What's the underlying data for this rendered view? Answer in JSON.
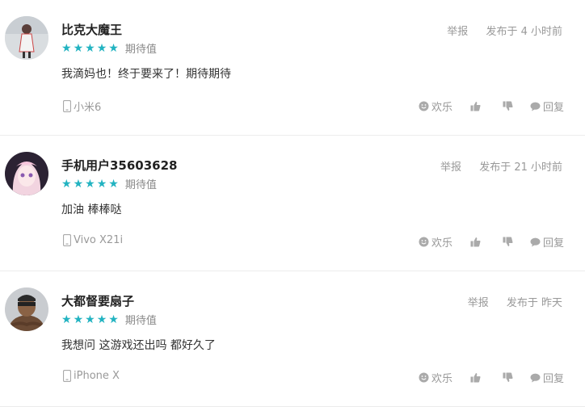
{
  "comments": [
    {
      "username": "比克大魔王",
      "report": "举报",
      "posted": "发布于 4 小时前",
      "rating_label": "期待值",
      "stars": 5,
      "content": "我滴妈也！终于要来了！期待期待",
      "device": "小米6",
      "actions": {
        "happy": "欢乐",
        "reply": "回复"
      }
    },
    {
      "username": "手机用户35603628",
      "report": "举报",
      "posted": "发布于 21 小时前",
      "rating_label": "期待值",
      "stars": 5,
      "content": "加油 棒棒哒",
      "device": "Vivo X21i",
      "actions": {
        "happy": "欢乐",
        "reply": "回复"
      }
    },
    {
      "username": "大都督要扇子",
      "report": "举报",
      "posted": "发布于 昨天",
      "rating_label": "期待值",
      "stars": 5,
      "content": "我想问 这游戏还出吗 都好久了",
      "device": "iPhone X",
      "actions": {
        "happy": "欢乐",
        "reply": "回复"
      }
    }
  ],
  "colors": {
    "star": "#22b3c1",
    "meta": "#999999",
    "divider": "#ececec"
  },
  "icons": [
    "phone-icon",
    "smiley-icon",
    "thumbs-up-icon",
    "thumbs-down-icon",
    "comment-bubble-icon"
  ]
}
